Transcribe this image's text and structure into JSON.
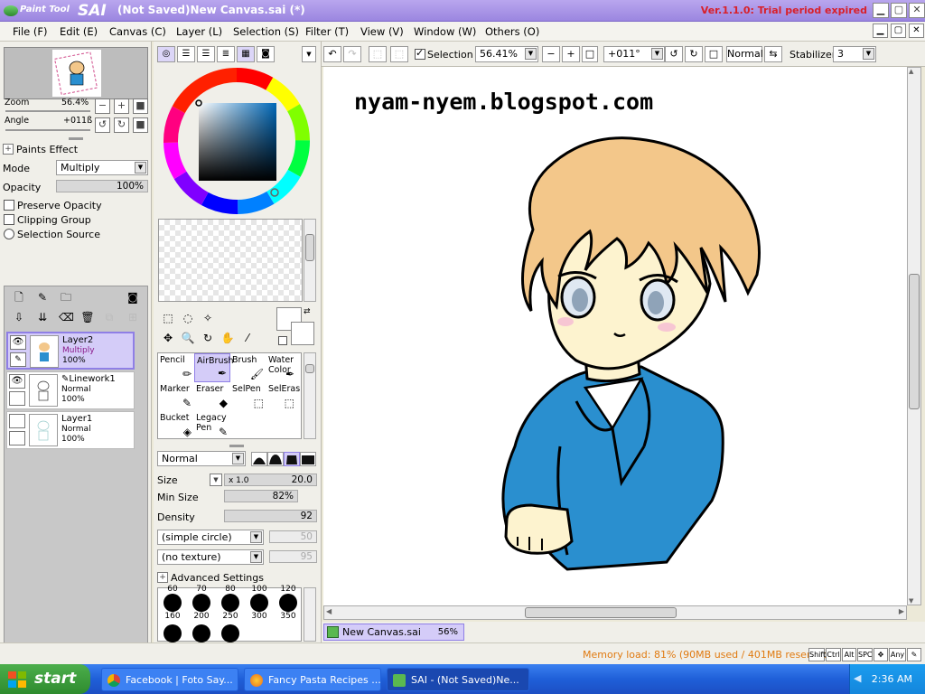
{
  "window": {
    "app_logo_small": "Paint Tool",
    "app_logo_big": "SAI",
    "title": "(Not Saved)New Canvas.sai (*)",
    "version": "Ver.1.1.0: Trial period expired"
  },
  "menu": [
    "File (F)",
    "Edit (E)",
    "Canvas (C)",
    "Layer (L)",
    "Selection (S)",
    "Filter (T)",
    "View (V)",
    "Window (W)",
    "Others (O)"
  ],
  "navigator": {
    "zoom_label": "Zoom",
    "zoom_value": "56.4%",
    "angle_label": "Angle",
    "angle_value": "+011ß"
  },
  "paints_effect": {
    "header": "Paints Effect",
    "mode_label": "Mode",
    "mode_value": "Multiply",
    "opacity_label": "Opacity",
    "opacity_value": "100%",
    "preserve_opacity": "Preserve Opacity",
    "clipping_group": "Clipping Group",
    "selection_source": "Selection Source"
  },
  "layers": [
    {
      "name": "Layer2",
      "mode": "Multiply",
      "opacity": "100%",
      "selected": true
    },
    {
      "name": "Linework1",
      "mode": "Normal",
      "opacity": "100%",
      "selected": false
    },
    {
      "name": "Layer1",
      "mode": "Normal",
      "opacity": "100%",
      "selected": false
    }
  ],
  "tools": [
    {
      "label": "Pencil",
      "label2": ""
    },
    {
      "label": "AirBrush",
      "label2": ""
    },
    {
      "label": "Brush",
      "label2": ""
    },
    {
      "label": "Water",
      "label2": "Color"
    },
    {
      "label": "Marker",
      "label2": ""
    },
    {
      "label": "Eraser",
      "label2": ""
    },
    {
      "label": "SelPen",
      "label2": ""
    },
    {
      "label": "SelEras",
      "label2": ""
    },
    {
      "label": "Bucket",
      "label2": ""
    },
    {
      "label": "Legacy",
      "label2": "Pen"
    }
  ],
  "brush": {
    "blend_mode": "Normal",
    "size_label": "Size",
    "size_mult": "x 1.0",
    "size_value": "20.0",
    "minsize_label": "Min Size",
    "minsize_value": "82%",
    "density_label": "Density",
    "density_value": "92",
    "shape": "(simple circle)",
    "shape_value": "50",
    "texture": "(no texture)",
    "texture_value": "95",
    "advanced": "Advanced Settings",
    "sizes_top": [
      "60",
      "70",
      "80",
      "100",
      "120"
    ],
    "sizes_bottom": [
      "160",
      "200",
      "250",
      "300",
      "350"
    ]
  },
  "toolbar": {
    "selection_label": "Selection",
    "zoom_value": "56.41%",
    "angle_value": "+011°",
    "blend_value": "Normal",
    "stabilizer_label": "Stabilizer",
    "stabilizer_value": "3"
  },
  "canvas": {
    "watermark": "nyam-nyem.blogspot.com"
  },
  "doc_tab": {
    "name": "New Canvas.sai",
    "zoom": "56%"
  },
  "status": {
    "memory": "Memory load: 81% (90MB used / 401MB reserved)",
    "keys": [
      "Shift",
      "Ctrl",
      "Alt",
      "SPC",
      "Any"
    ]
  },
  "taskbar": {
    "start": "start",
    "tasks": [
      {
        "label": "Facebook | Foto Say...",
        "icon_color": "#e8b830"
      },
      {
        "label": "Fancy Pasta Recipes ...",
        "icon_color": "#e86a20"
      },
      {
        "label": "SAI - (Not Saved)Ne...",
        "icon_color": "#5ab850"
      }
    ],
    "clock": "2:36 AM"
  },
  "colors": {
    "accent": "#8f7fe6",
    "title_bg": "#a893e8",
    "version_red": "#d8202a",
    "memory_orange": "#e07a10",
    "hair": "#f3c78a",
    "jacket": "#2a8fcf"
  }
}
